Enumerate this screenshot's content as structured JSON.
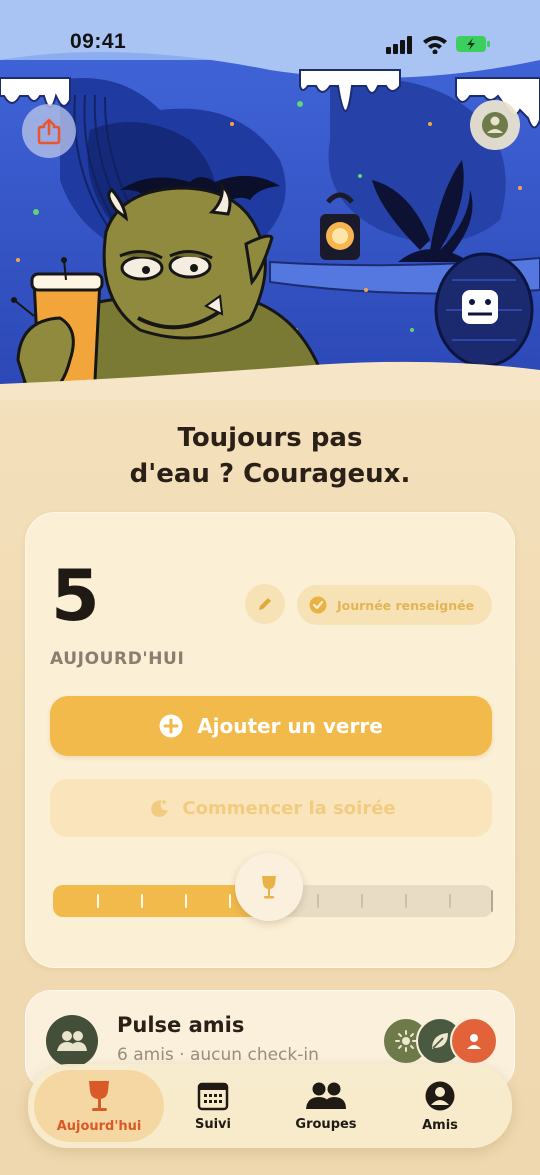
{
  "status_bar": {
    "time": "09:41"
  },
  "header": {
    "share_icon": "share-icon",
    "profile_icon": "profile-icon",
    "illustration": "ogre-with-beer-in-cave"
  },
  "headline": {
    "line1": "Toujours pas",
    "line2": "d'eau ? Courageux."
  },
  "today_card": {
    "count": "5",
    "label": "AUJOURD'HUI",
    "edit_icon": "pencil-icon",
    "day_status": "Journée renseignée",
    "add_button": "Ajouter un verre",
    "night_button": "Commencer la soirée",
    "slider_level": 0.49
  },
  "pulse": {
    "title": "Pulse amis",
    "subtitle": "6 amis · aucun check-in"
  },
  "tabs": [
    {
      "label": "Aujourd'hui",
      "icon": "wine-glass-icon",
      "active": true
    },
    {
      "label": "Suivi",
      "icon": "calendar-icon",
      "active": false
    },
    {
      "label": "Groupes",
      "icon": "group-icon",
      "active": false
    },
    {
      "label": "Amis",
      "icon": "person-icon",
      "active": false
    }
  ],
  "colors": {
    "accent": "#f2ba4a",
    "active_tab": "#d95a28",
    "background": "#f3dfba",
    "sky": "#3f63d6"
  }
}
